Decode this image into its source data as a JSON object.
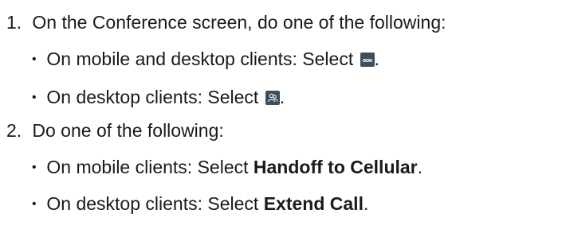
{
  "steps": [
    {
      "number": "1.",
      "text": "On the Conference screen, do one of the following:",
      "bullets": [
        {
          "prefix": "On mobile and desktop clients: Select ",
          "icon": "more-options-icon",
          "suffix": "."
        },
        {
          "prefix": "On desktop clients: Select ",
          "icon": "participants-icon",
          "suffix": "."
        }
      ]
    },
    {
      "number": "2.",
      "text": "Do one of the following:",
      "bullets": [
        {
          "prefix": "On mobile clients: Select ",
          "bold": "Handoff to Cellular",
          "suffix": "."
        },
        {
          "prefix": "On desktop clients: Select ",
          "bold": "Extend Call",
          "suffix": "."
        }
      ]
    }
  ],
  "colors": {
    "text": "#1a1a1a",
    "icon_background": "#3c4f5f",
    "icon_glyph": "#ffffff"
  }
}
